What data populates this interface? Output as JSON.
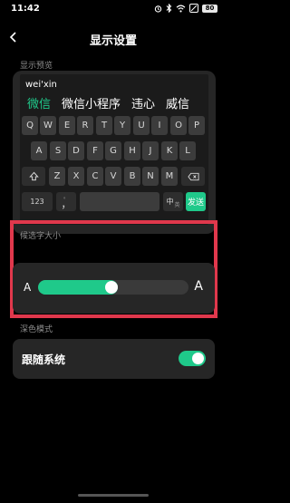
{
  "status_bar": {
    "time": "11:42",
    "battery": "80",
    "icons": [
      "alarm-icon",
      "bluetooth-icon",
      "wifi-icon",
      "mute-icon",
      "battery-icon"
    ]
  },
  "header": {
    "title": "显示设置",
    "back_icon": "chevron-left-icon"
  },
  "preview": {
    "section_label": "显示预览",
    "pinyin": "wei'xin",
    "candidates": [
      "微信",
      "微信小程序",
      "违心",
      "威信"
    ],
    "rows": [
      [
        "Q",
        "W",
        "E",
        "R",
        "T",
        "Y",
        "U",
        "I",
        "O",
        "P"
      ],
      [
        "A",
        "S",
        "D",
        "F",
        "G",
        "H",
        "J",
        "K",
        "L"
      ],
      [
        "Z",
        "X",
        "C",
        "V",
        "B",
        "N",
        "M"
      ]
    ],
    "bottom": {
      "num": "123",
      "punct": "，",
      "punct_hint": "。",
      "lang": "中",
      "lang_hint": "英",
      "send": "发送"
    }
  },
  "font_size": {
    "section_label": "候选字大小",
    "small_a": "A",
    "large_a": "A",
    "level": 0.48
  },
  "dark_mode": {
    "section_label": "深色模式",
    "follow_system_label": "跟随系统",
    "follow_system_on": true
  },
  "colors": {
    "accent": "#1fc98a",
    "highlight": "#e0384c",
    "background": "#000000",
    "card": "#262626"
  }
}
